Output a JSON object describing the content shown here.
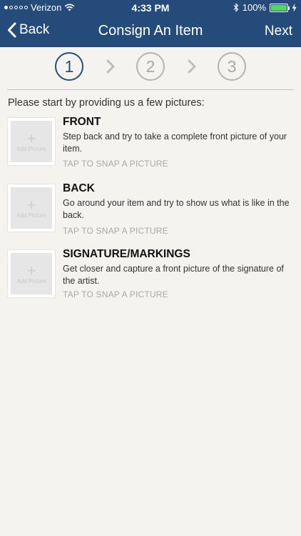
{
  "status": {
    "carrier": "Verizon",
    "time": "4:33 PM",
    "battery": "100%",
    "battery_level": 1.0,
    "signal_bars": 1
  },
  "nav": {
    "back_label": "Back",
    "title": "Consign An Item",
    "next_label": "Next"
  },
  "steps": [
    {
      "label": "1"
    },
    {
      "label": "2"
    },
    {
      "label": "3"
    }
  ],
  "active_step": 1,
  "intro": "Please start by providing us a few pictures:",
  "items": [
    {
      "title": "FRONT",
      "description": "Step back and try to take a complete front picture of your item.",
      "action": "TAP TO SNAP A PICTURE",
      "thumb_label": "Add Picture"
    },
    {
      "title": "BACK",
      "description": "Go around your item and try to show us what is like in the back.",
      "action": "TAP TO SNAP A PICTURE",
      "thumb_label": "Add Picture"
    },
    {
      "title": "SIGNATURE/MARKINGS",
      "description": "Get closer and capture a front picture of the signature of the artist.",
      "action": "TAP TO SNAP A PICTURE",
      "thumb_label": "Add Picture"
    }
  ],
  "colors": {
    "nav_background": "#244b7a",
    "active_step": "#2a4d77",
    "inactive_step": "#b4b4b4",
    "page_background": "#f5f3ef",
    "battery": "#4cd964"
  }
}
